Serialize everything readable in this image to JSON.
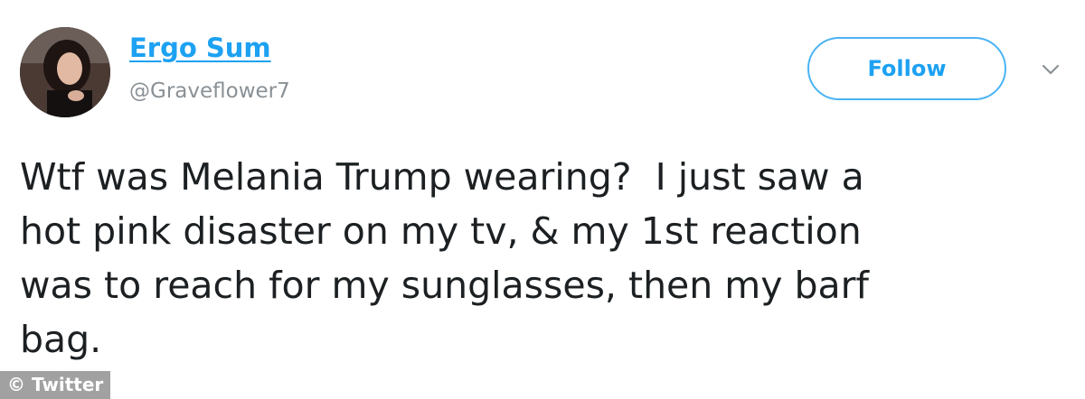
{
  "user": {
    "display_name": "Ergo Sum",
    "handle": "@Graveflower7"
  },
  "actions": {
    "follow_label": "Follow",
    "menu_icon": "chevron-down-icon"
  },
  "tweet": {
    "text": "Wtf was Melania Trump wearing?  I just saw a\nhot pink disaster on my tv, & my 1st reaction\nwas to reach for my sunglasses, then my barf\nbag."
  },
  "watermark": {
    "text": "© Twitter"
  },
  "colors": {
    "accent": "#1da1f2",
    "handle": "#8a9196",
    "text": "#1c2022"
  }
}
